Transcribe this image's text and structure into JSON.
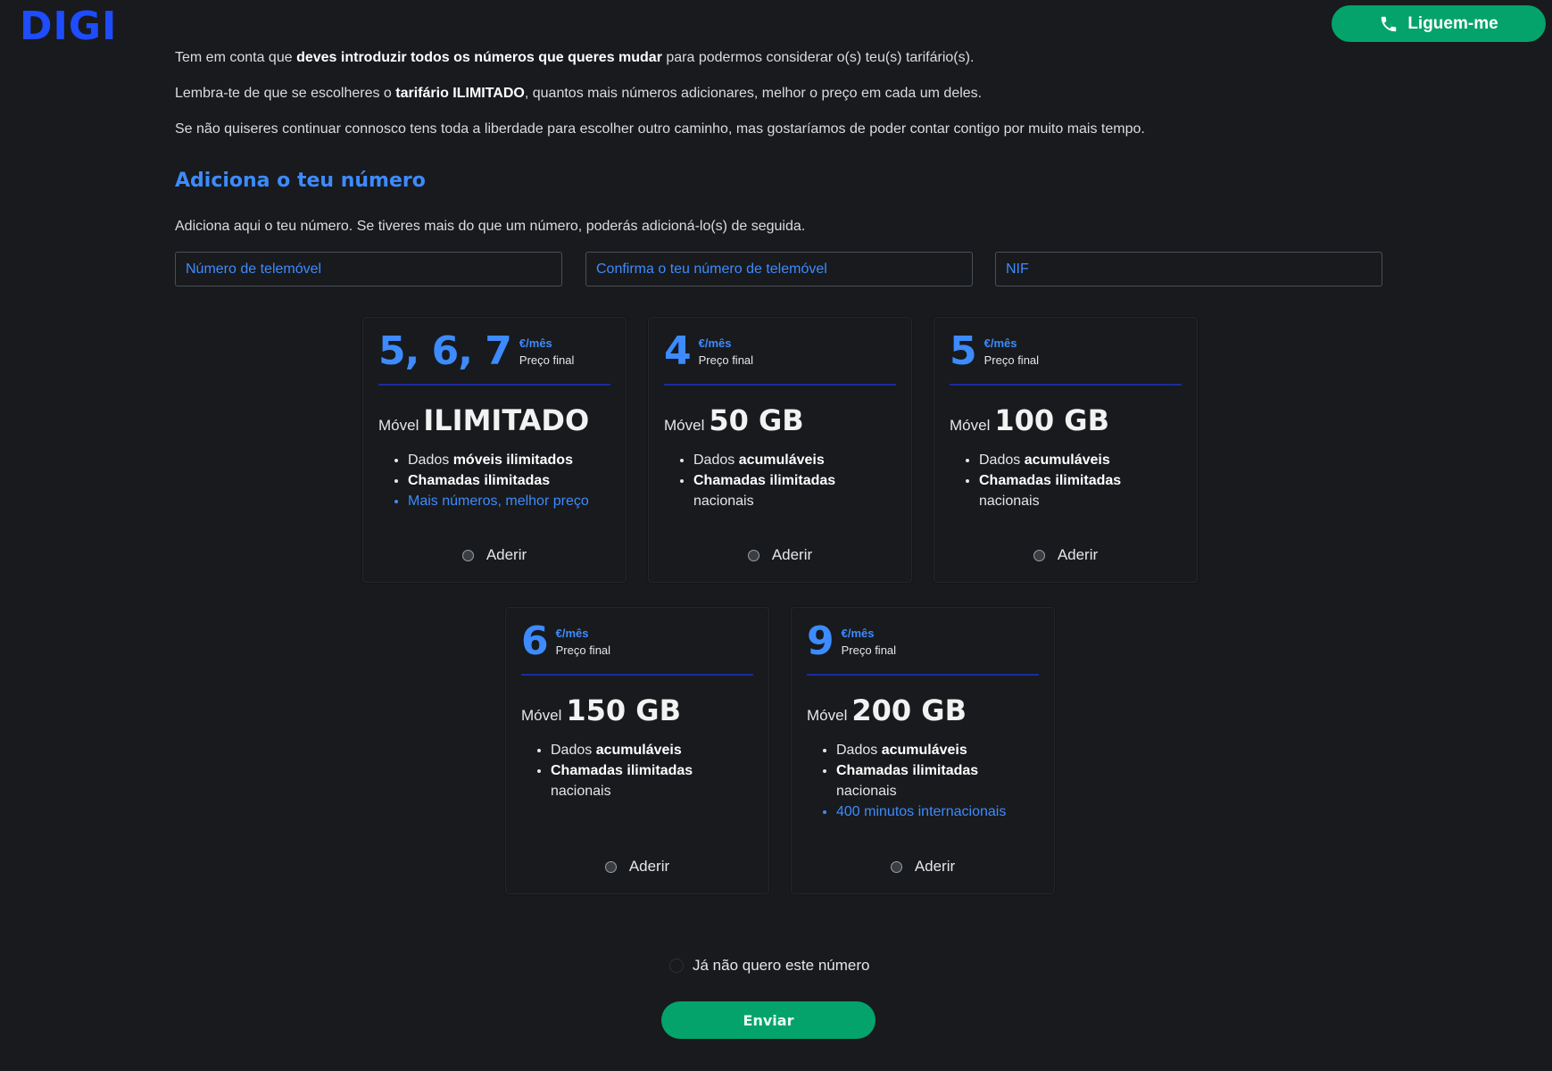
{
  "header": {
    "logo": "DIGI",
    "call_button": "Liguem-me"
  },
  "intro": {
    "p1_a": "Tem em conta que ",
    "p1_b": "deves introduzir todos os números que queres mudar",
    "p1_c": " para podermos considerar o(s) teu(s) tarifário(s).",
    "p2_a": "Lembra-te de que se escolheres o ",
    "p2_b": "tarifário ILIMITADO",
    "p2_c": ", quantos mais números adicionares, melhor o preço em cada um deles.",
    "p3": "Se não quiseres continuar connosco tens toda a liberdade para escolher outro caminho, mas gostaríamos de poder contar contigo por muito mais tempo."
  },
  "section": {
    "title": "Adiciona o teu número",
    "subtitle": "Adiciona aqui o teu número. Se tiveres mais do que um número, poderás adicioná-lo(s) de seguida."
  },
  "fields": {
    "phone_placeholder": "Número de telemóvel",
    "confirm_placeholder": "Confirma o teu número de telemóvel",
    "nif_placeholder": "NIF"
  },
  "plans": [
    {
      "price": "5, 6, 7",
      "unit": "€/mês",
      "price_note": "Preço final",
      "movel": "Móvel",
      "data": "ILIMITADO",
      "b1_a": "Dados ",
      "b1_b": "móveis ilimitados",
      "b2": "Chamadas ilimitadas",
      "b2_c": "",
      "b3": "Mais números, melhor preço",
      "adherir": "Aderir"
    },
    {
      "price": "4",
      "unit": "€/mês",
      "price_note": "Preço final",
      "movel": "Móvel",
      "data": "50 GB",
      "b1_a": "Dados ",
      "b1_b": "acumuláveis",
      "b2": "Chamadas ilimitadas",
      "b2_c": "nacionais",
      "adherir": "Aderir"
    },
    {
      "price": "5",
      "unit": "€/mês",
      "price_note": "Preço final",
      "movel": "Móvel",
      "data": "100 GB",
      "b1_a": "Dados ",
      "b1_b": "acumuláveis",
      "b2": "Chamadas ilimitadas",
      "b2_c": "nacionais",
      "adherir": "Aderir"
    },
    {
      "price": "6",
      "unit": "€/mês",
      "price_note": "Preço final",
      "movel": "Móvel",
      "data": "150 GB",
      "b1_a": "Dados ",
      "b1_b": "acumuláveis",
      "b2": "Chamadas ilimitadas",
      "b2_c": "nacionais",
      "adherir": "Aderir"
    },
    {
      "price": "9",
      "unit": "€/mês",
      "price_note": "Preço final",
      "movel": "Móvel",
      "data": "200 GB",
      "b1_a": "Dados ",
      "b1_b": "acumuláveis",
      "b2": "Chamadas ilimitadas",
      "b2_c": "nacionais",
      "b3": "400 minutos internacionais",
      "adherir": "Aderir"
    }
  ],
  "footer": {
    "no_keep": "Já não quero este número",
    "send": "Enviar"
  },
  "colors": {
    "accent_blue": "#3d8bff",
    "logo_blue": "#1e4cff",
    "green": "#04a36b",
    "background": "#181a1d"
  },
  "icons": {
    "call_button_icon": "phone-icon"
  }
}
